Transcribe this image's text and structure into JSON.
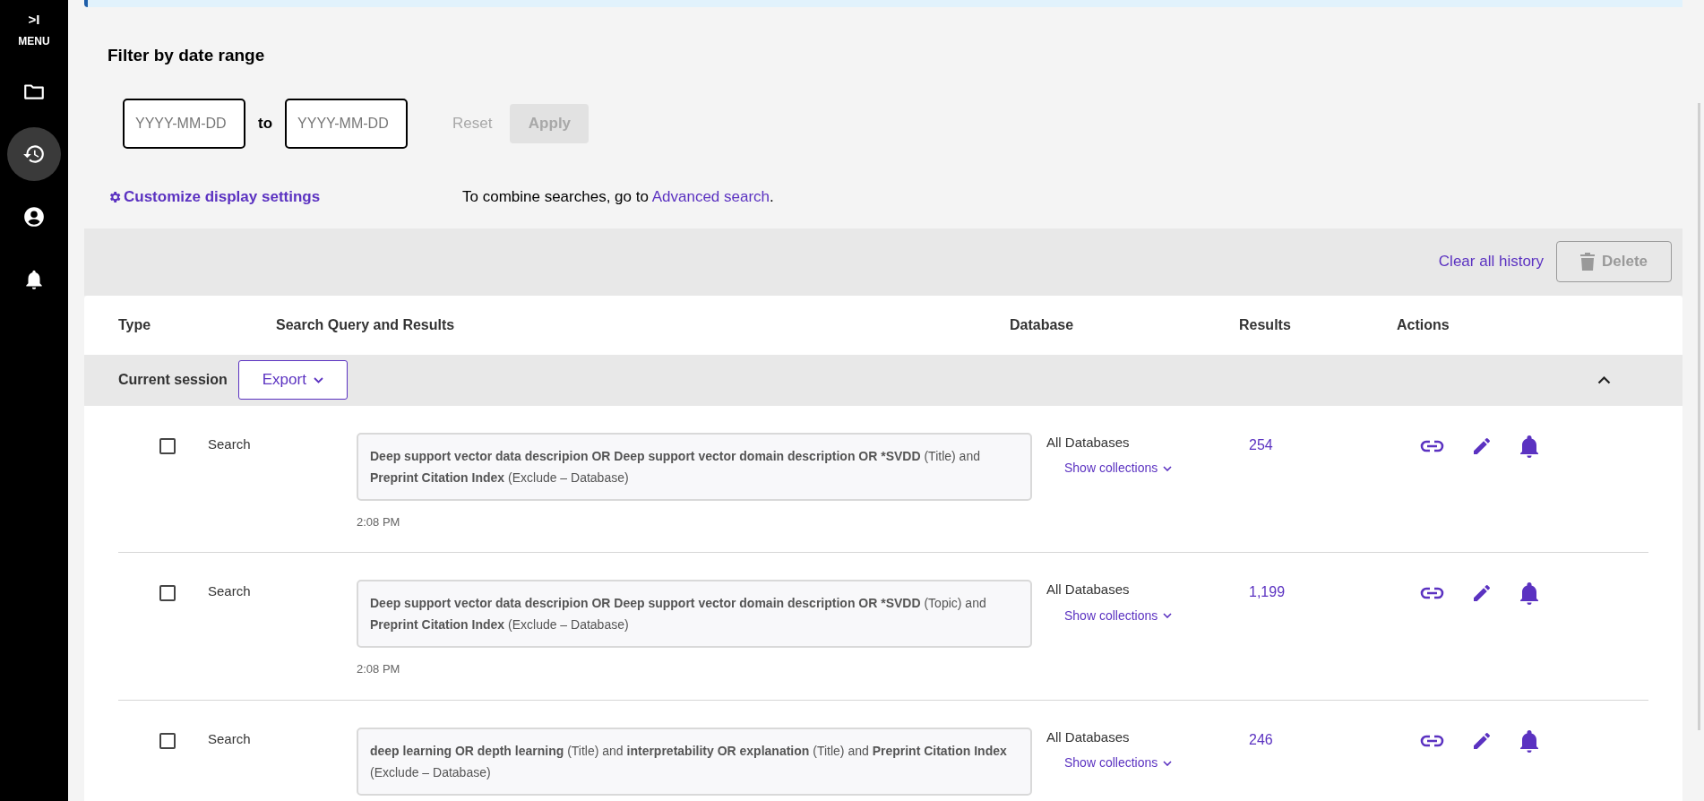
{
  "sidebar": {
    "toggle": ">I",
    "menu_label": "MENU",
    "items": [
      {
        "kind": "folder",
        "selected": false
      },
      {
        "kind": "history",
        "selected": true
      },
      {
        "kind": "account",
        "selected": false
      },
      {
        "kind": "alerts",
        "selected": false
      }
    ]
  },
  "filter": {
    "title": "Filter by date range",
    "from": {
      "placeholder": "YYYY-MM-DD"
    },
    "separator": "to",
    "until": {
      "placeholder": "YYYY-MM-DD"
    },
    "reset": {
      "label": "Reset",
      "disabled": true
    },
    "apply": {
      "label": "Apply",
      "disabled": true
    }
  },
  "customize_link": "Customize display settings",
  "combine_note": {
    "text": "To combine searches, go to",
    "link": "Advanced search",
    "end": "."
  },
  "toolbar": {
    "clear_link": "Clear all history",
    "delete": {
      "label": "Delete",
      "disabled": true
    }
  },
  "table": {
    "columns": [
      "Type",
      "Search Query and Results",
      "Database",
      "Results",
      "Actions"
    ],
    "session": {
      "label": "Current session",
      "export": "Export",
      "expanded": true
    },
    "rows": [
      {
        "checked": false,
        "type": "Search",
        "query": "**Deep support vector data descripion OR Deep support vector domain description OR *SVDD** (Title) and **Preprint Citation Index** (Exclude – Database)",
        "time": "2:08 PM",
        "database": "All Databases",
        "collections": "Show collections",
        "results": "254"
      },
      {
        "checked": false,
        "type": "Search",
        "query": "**Deep support vector data descripion OR Deep support vector domain description OR *SVDD** (Topic) and **Preprint Citation Index** (Exclude – Database)",
        "time": "2:08 PM",
        "database": "All Databases",
        "collections": "Show collections",
        "results": "1,199"
      },
      {
        "checked": false,
        "type": "Search",
        "query": "**deep learning OR depth learning** (Title) and **interpretability OR explanation** (Title) and **Preprint Citation Index** (Exclude – Database)",
        "database": "All Databases",
        "collections": "Show collections",
        "results": "246"
      }
    ]
  }
}
